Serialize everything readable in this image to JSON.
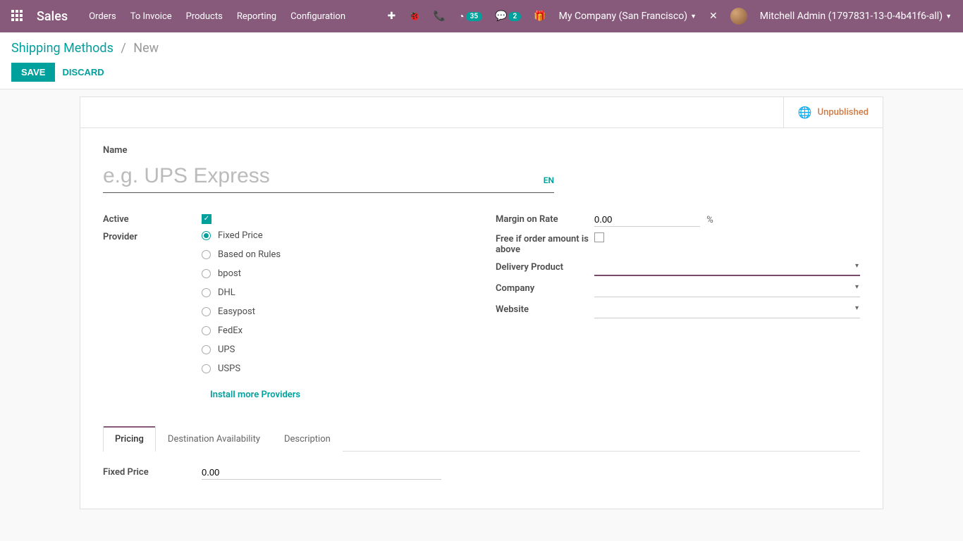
{
  "topbar": {
    "brand": "Sales",
    "menu": [
      "Orders",
      "To Invoice",
      "Products",
      "Reporting",
      "Configuration"
    ],
    "clock_badge": "35",
    "chat_badge": "2",
    "company": "My Company (San Francisco)",
    "user": "Mitchell Admin (1797831-13-0-4b41f6-all)"
  },
  "breadcrumb": {
    "parent": "Shipping Methods",
    "current": "New"
  },
  "buttons": {
    "save": "SAVE",
    "discard": "DISCARD"
  },
  "status": {
    "unpublished": "Unpublished"
  },
  "form": {
    "name_label": "Name",
    "name_placeholder": "e.g. UPS Express",
    "lang": "EN",
    "active_label": "Active",
    "active": true,
    "provider_label": "Provider",
    "providers": [
      "Fixed Price",
      "Based on Rules",
      "bpost",
      "DHL",
      "Easypost",
      "FedEx",
      "UPS",
      "USPS"
    ],
    "provider_selected": 0,
    "install_link": "Install more Providers",
    "margin_label": "Margin on Rate",
    "margin_value": "0.00",
    "margin_suffix": "%",
    "free_label": "Free if order amount is above",
    "delivery_product_label": "Delivery Product",
    "company_label": "Company",
    "website_label": "Website"
  },
  "tabs": {
    "items": [
      "Pricing",
      "Destination Availability",
      "Description"
    ],
    "active": 0,
    "fixed_price_label": "Fixed Price",
    "fixed_price_value": "0.00"
  }
}
